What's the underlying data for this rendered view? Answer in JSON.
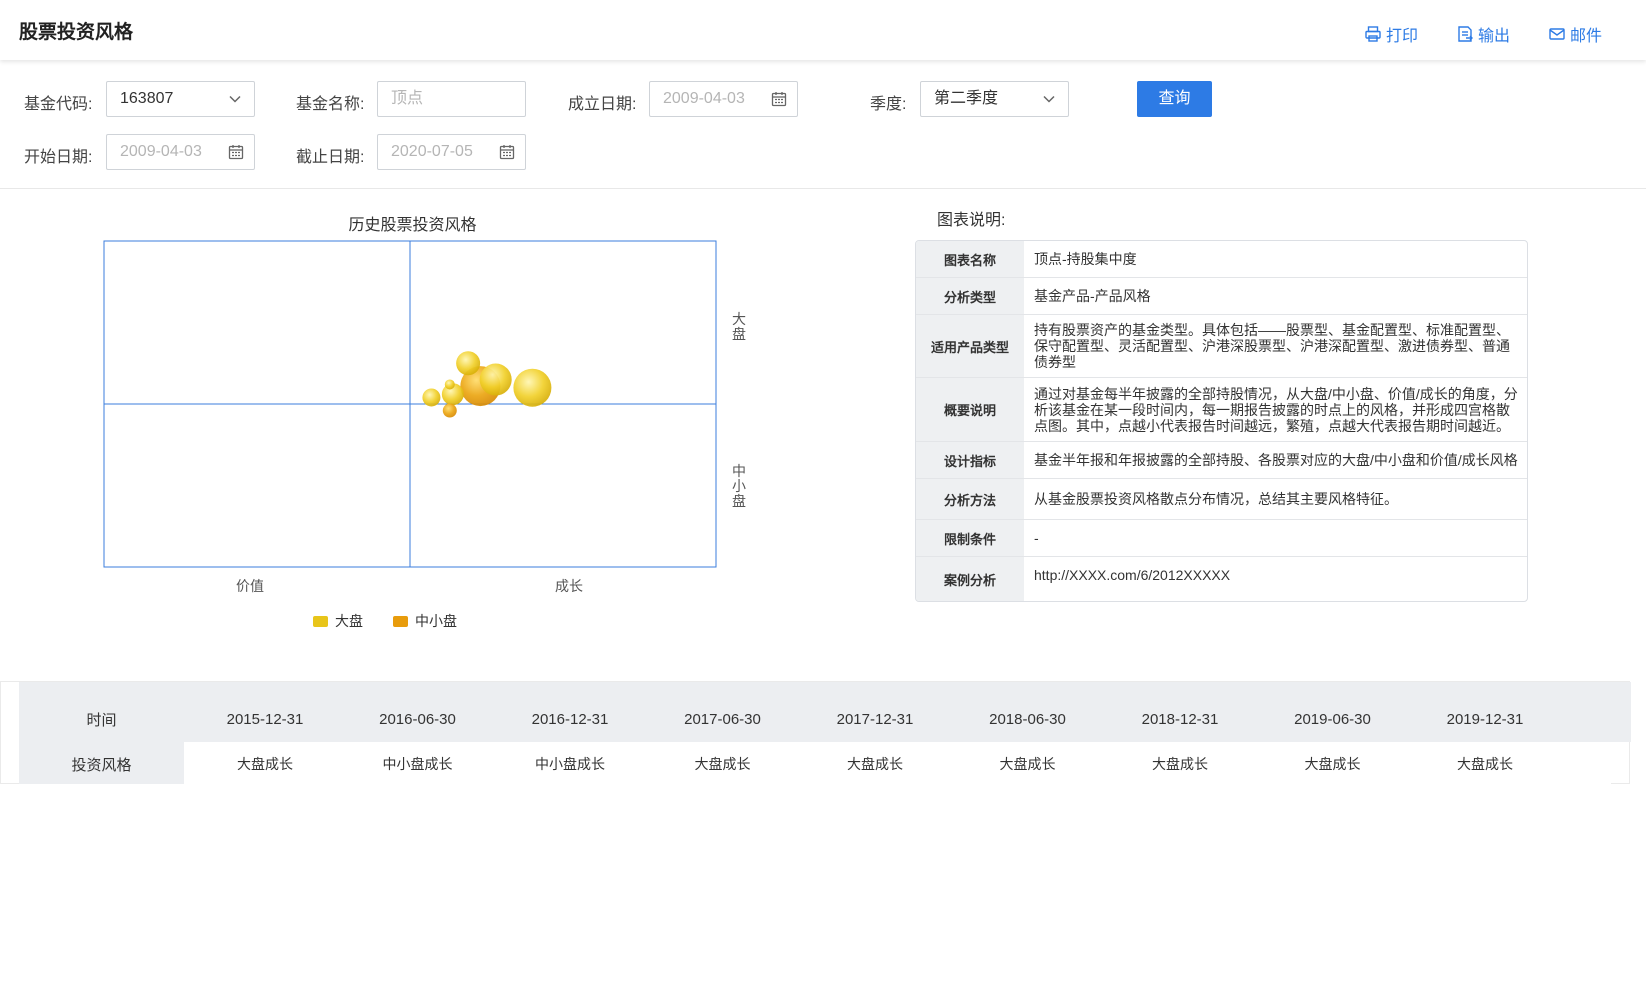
{
  "header": {
    "title": "股票投资风格",
    "actions": [
      {
        "label": "打印",
        "icon": "printer-icon"
      },
      {
        "label": "输出",
        "icon": "export-icon"
      },
      {
        "label": "邮件",
        "icon": "mail-icon"
      }
    ]
  },
  "filters": {
    "fund_code": {
      "label": "基金代码:",
      "value": "163807"
    },
    "fund_name": {
      "label": "基金名称:",
      "placeholder": "顶点"
    },
    "found_date": {
      "label": "成立日期:",
      "placeholder": "2009-04-03"
    },
    "quarter": {
      "label": "季度:",
      "value": "第二季度"
    },
    "start_date": {
      "label": "开始日期:",
      "placeholder": "2009-04-03"
    },
    "end_date": {
      "label": "截止日期:",
      "placeholder": "2020-07-05"
    },
    "query_label": "查询"
  },
  "chart_data": {
    "type": "scatter",
    "title": "历史股票投资风格",
    "x_labels": [
      "价值",
      "成长"
    ],
    "y_labels": [
      "大盘",
      "中小盘"
    ],
    "xlim": [
      -1,
      1
    ],
    "ylim": [
      -1,
      1
    ],
    "grid": false,
    "legend_position": "bottom",
    "series": [
      {
        "name": "大盘",
        "color": "#e8c51a",
        "points": [
          {
            "x": 0.19,
            "y": 0.25,
            "size": 12
          },
          {
            "x": 0.28,
            "y": 0.15,
            "size": 16
          },
          {
            "x": 0.4,
            "y": 0.1,
            "size": 19
          },
          {
            "x": 0.13,
            "y": 0.12,
            "size": 5
          },
          {
            "x": 0.07,
            "y": 0.04,
            "size": 9
          },
          {
            "x": 0.14,
            "y": 0.06,
            "size": 11
          }
        ]
      },
      {
        "name": "中小盘",
        "color": "#e89c0c",
        "points": [
          {
            "x": 0.23,
            "y": 0.11,
            "size": 20
          },
          {
            "x": 0.13,
            "y": -0.04,
            "size": 7
          }
        ]
      }
    ]
  },
  "description": {
    "title": "图表说明:",
    "rows": [
      {
        "key": "图表名称",
        "value": "顶点-持股集中度"
      },
      {
        "key": "分析类型",
        "value": "基金产品-产品风格"
      },
      {
        "key": "适用产品类型",
        "value": "持有股票资产的基金类型。具体包括——股票型、基金配置型、标准配置型、保守配置型、灵活配置型、沪港深股票型、沪港深配置型、激进债券型、普通债券型"
      },
      {
        "key": "概要说明",
        "value": "通过对基金每半年披露的全部持股情况，从大盘/中小盘、价值/成长的角度，分析该基金在某一段时间内，每一期报告披露的时点上的风格，并形成四宫格散点图。其中，点越小代表报告时间越远，繁殖，点越大代表报告期时间越近。"
      },
      {
        "key": "设计指标",
        "value": "基金半年报和年报披露的全部持股、各股票对应的大盘/中小盘和价值/成长风格"
      },
      {
        "key": "分析方法",
        "value": "从基金股票投资风格散点分布情况，总结其主要风格特征。"
      },
      {
        "key": "限制条件",
        "value": "-"
      },
      {
        "key": "案例分析",
        "value": "http://XXXX.com/6/2012XXXXX"
      }
    ]
  },
  "history": {
    "time_label": "时间",
    "style_label": "投资风格",
    "dates": [
      "2015-12-31",
      "2016-06-30",
      "2016-12-31",
      "2017-06-30",
      "2017-12-31",
      "2018-06-30",
      "2018-12-31",
      "2019-06-30",
      "2019-12-31"
    ],
    "styles": [
      "大盘成长",
      "中小盘成长",
      "中小盘成长",
      "大盘成长",
      "大盘成长",
      "大盘成长",
      "大盘成长",
      "大盘成长",
      "大盘成长"
    ]
  }
}
